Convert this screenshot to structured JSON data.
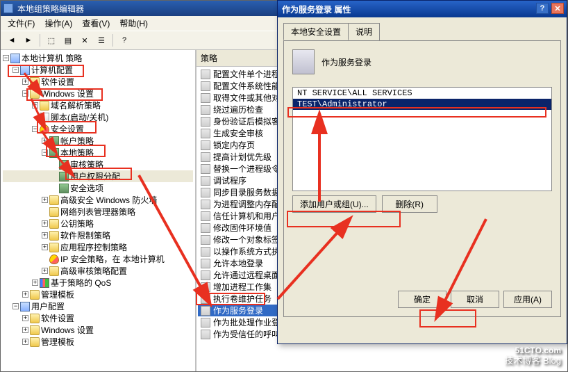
{
  "window": {
    "title": "本地组策略编辑器",
    "menus": {
      "file": "文件(F)",
      "action": "操作(A)",
      "view": "查看(V)",
      "help": "帮助(H)"
    }
  },
  "tree": {
    "root": "本地计算机 策略",
    "computer": "计算机配置",
    "softSettings": "软件设置",
    "winSettings": "Windows 设置",
    "nameRes": "域名解析策略",
    "scripts": "脚本(启动/关机)",
    "security": "安全设置",
    "accountPol": "帐户策略",
    "localPol": "本地策略",
    "auditPol": "审核策略",
    "userRights": "用户权限分配",
    "secOptions": "安全选项",
    "advFirewall": "高级安全 Windows 防火墙",
    "netList": "网络列表管理器策略",
    "pubKey": "公钥策略",
    "softRestrict": "软件限制策略",
    "appCtrl": "应用程序控制策略",
    "ipSec": "IP 安全策略，在 本地计算机",
    "advAudit": "高级审核策略配置",
    "qos": "基于策略的 QoS",
    "adminTpl": "管理模板",
    "userCfg": "用户配置",
    "uSoft": "软件设置",
    "uWin": "Windows 设置",
    "uTpl": "管理模板"
  },
  "list": {
    "header": "策略",
    "items": [
      "配置文件单个进程",
      "配置文件系统性能",
      "取得文件或其他对",
      "绕过遍历检查",
      "身份验证后模拟客",
      "生成安全审核",
      "锁定内存页",
      "提高计划优先级",
      "替换一个进程级令",
      "调试程序",
      "同步目录服务数据",
      "为进程调整内存配",
      "信任计算机和用户",
      "修改固件环境值",
      "修改一个对象标签",
      "以操作系统方式执",
      "允许本地登录",
      "允许通过远程桌面",
      "增加进程工作集",
      "执行卷维护任务",
      "作为服务登录",
      "作为批处理作业登",
      "作为受信任的呼叫方访问凭据管理器"
    ],
    "selectedIndex": 20
  },
  "dialog": {
    "title": "作为服务登录 属性",
    "tabs": {
      "local": "本地安全设置",
      "explain": "说明"
    },
    "policyName": "作为服务登录",
    "users": [
      "NT SERVICE\\ALL SERVICES",
      "TEST\\Administrator"
    ],
    "selectedUserIndex": 1,
    "addBtn": "添加用户或组(U)...",
    "removeBtn": "删除(R)",
    "okBtn": "确定",
    "cancelBtn": "取消",
    "applyBtn": "应用(A)"
  },
  "watermark": {
    "line1": "51CTO.com",
    "line2": "技术博客   Blog"
  }
}
